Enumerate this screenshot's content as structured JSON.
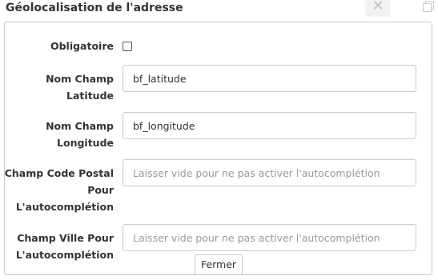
{
  "dialog": {
    "title": "Géolocalisation de l'adresse",
    "close_symbol": "✕"
  },
  "icons": {
    "close": "close-icon",
    "copy": "copy-icon"
  },
  "fields": {
    "obligatoire": {
      "label": "Obligatoire",
      "checked": false
    },
    "latitude": {
      "label_line1": "Nom Champ",
      "label_line2": "Latitude",
      "value": "bf_latitude"
    },
    "longitude": {
      "label_line1": "Nom Champ",
      "label_line2": "Longitude",
      "value": "bf_longitude"
    },
    "code_postal": {
      "label_line1": "Champ Code Postal",
      "label_line2": "Pour",
      "label_line3": "L'autocomplétion",
      "value": "",
      "placeholder": "Laisser vide pour ne pas activer l'autocomplétion"
    },
    "ville": {
      "label_line1": "Champ Ville Pour",
      "label_line2": "L'autocomplétion",
      "value": "",
      "placeholder": "Laisser vide pour ne pas activer l'autocomplétion"
    }
  },
  "actions": {
    "close_label": "Fermer"
  }
}
